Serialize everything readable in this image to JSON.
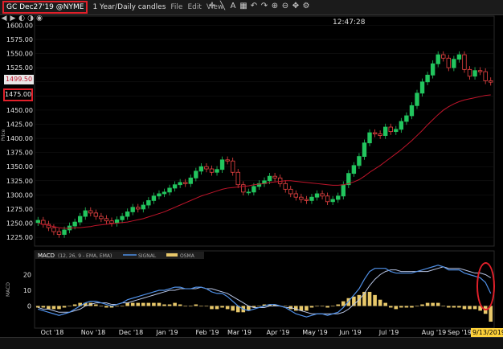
{
  "toolbar": {
    "symbol": "GC Dec27'19 @NYME",
    "timeframe": "1 Year/Daily candles",
    "menus": [
      "File",
      "Edit",
      "View"
    ],
    "icons": [
      "crosshair-icon",
      "draw-line-icon",
      "text-tool-icon",
      "grid-icon",
      "undo-icon",
      "redo-icon",
      "zoom-in-icon",
      "zoom-out-icon",
      "pan-icon",
      "settings-icon"
    ]
  },
  "clock": "12:47:28",
  "price_scale": {
    "ticks": [
      "1600.00",
      "1575.00",
      "1550.00",
      "1525.00",
      "1500.00",
      "1475.00",
      "1450.00",
      "1425.00",
      "1400.00",
      "1375.00",
      "1350.00",
      "1325.00",
      "1300.00",
      "1275.00",
      "1250.00",
      "1225.00"
    ],
    "axis_label": "Price",
    "last_price": "1499.50",
    "highlighted_price": "1475.00"
  },
  "time_axis": [
    "Oct '18",
    "Nov '18",
    "Dec '18",
    "Jan '19",
    "Feb '19",
    "Mar '19",
    "Apr '19",
    "May '19",
    "Jun '19",
    "Jul '19",
    "Aug '19",
    "Sep '19"
  ],
  "macd_panel": {
    "legend": {
      "label": "MACD",
      "params": "(12, 26, 9 - EMA, EMA)",
      "series_signal": "SIGNAL",
      "series_osma": "OSMA"
    },
    "ticks": [
      "20",
      "10",
      "0"
    ],
    "axis_label": "MACD"
  },
  "current_date": "9/13/2019",
  "colors": {
    "up_candle": "#22c55e",
    "down_candle": "#ef4444",
    "moving_average": "#c0152b",
    "macd_line": "#4f8fe6",
    "signal_line": "#b9c6e6",
    "osma_bar": "#e8c86a",
    "highlight": "#e0202a",
    "date_badge": "#ffd23a"
  },
  "chart_data": {
    "type": "candlestick",
    "ylim": [
      1218,
      1605
    ],
    "moving_average_period": "not labeled",
    "closes": [
      1255,
      1248,
      1242,
      1235,
      1230,
      1238,
      1245,
      1252,
      1262,
      1272,
      1268,
      1262,
      1258,
      1254,
      1250,
      1256,
      1262,
      1270,
      1278,
      1275,
      1282,
      1290,
      1298,
      1302,
      1305,
      1312,
      1318,
      1322,
      1320,
      1330,
      1342,
      1350,
      1346,
      1340,
      1345,
      1362,
      1360,
      1340,
      1318,
      1305,
      1305,
      1315,
      1320,
      1325,
      1333,
      1330,
      1320,
      1310,
      1302,
      1296,
      1292,
      1290,
      1296,
      1302,
      1298,
      1288,
      1292,
      1298,
      1318,
      1338,
      1352,
      1368,
      1392,
      1410,
      1408,
      1405,
      1420,
      1412,
      1416,
      1430,
      1440,
      1458,
      1480,
      1500,
      1512,
      1532,
      1548,
      1542,
      1525,
      1540,
      1548,
      1522,
      1510,
      1520,
      1518,
      1502,
      1499.5
    ],
    "moving_average": [
      1250,
      1248,
      1246,
      1244,
      1242,
      1241,
      1241,
      1242,
      1242,
      1243,
      1244,
      1246,
      1247,
      1248,
      1249,
      1250,
      1251,
      1252,
      1254,
      1256,
      1258,
      1261,
      1264,
      1267,
      1270,
      1274,
      1278,
      1282,
      1286,
      1290,
      1294,
      1298,
      1301,
      1304,
      1307,
      1310,
      1312,
      1313,
      1314,
      1315,
      1316,
      1318,
      1319,
      1320,
      1322,
      1323,
      1324,
      1325,
      1325,
      1324,
      1323,
      1322,
      1321,
      1320,
      1319,
      1318,
      1317,
      1317,
      1318,
      1320,
      1323,
      1327,
      1333,
      1340,
      1346,
      1352,
      1359,
      1366,
      1373,
      1380,
      1388,
      1396,
      1405,
      1414,
      1424,
      1433,
      1442,
      1450,
      1456,
      1461,
      1465,
      1468,
      1470,
      1472,
      1474,
      1476,
      1477
    ],
    "macd": [
      -2,
      -3,
      -4,
      -5,
      -6,
      -5,
      -4,
      -2,
      0,
      2,
      3,
      3,
      2,
      1,
      0,
      1,
      2,
      4,
      5,
      6,
      7,
      8,
      9,
      10,
      10,
      11,
      12,
      12,
      11,
      11,
      12,
      12,
      11,
      9,
      8,
      8,
      6,
      3,
      0,
      -2,
      -3,
      -2,
      -1,
      0,
      1,
      1,
      0,
      -1,
      -3,
      -5,
      -6,
      -7,
      -6,
      -5,
      -5,
      -6,
      -5,
      -4,
      -1,
      3,
      7,
      11,
      17,
      22,
      24,
      24,
      24,
      22,
      21,
      21,
      21,
      21,
      22,
      23,
      24,
      25,
      26,
      25,
      23,
      23,
      23,
      21,
      20,
      19,
      18,
      15,
      8
    ],
    "signal": [
      -1,
      -2,
      -2,
      -3,
      -4,
      -4,
      -4,
      -3,
      -2,
      0,
      1,
      2,
      2,
      2,
      1,
      1,
      2,
      2,
      3,
      4,
      5,
      6,
      7,
      8,
      9,
      10,
      10,
      11,
      11,
      11,
      11,
      12,
      11,
      11,
      10,
      9,
      8,
      6,
      4,
      2,
      0,
      -1,
      -1,
      -1,
      0,
      0,
      0,
      -1,
      -1,
      -2,
      -3,
      -4,
      -5,
      -5,
      -5,
      -5,
      -5,
      -5,
      -4,
      -2,
      1,
      4,
      8,
      13,
      17,
      20,
      22,
      23,
      23,
      22,
      22,
      22,
      22,
      22,
      22,
      23,
      24,
      25,
      24,
      24,
      24,
      23,
      22,
      21,
      21,
      20,
      18
    ],
    "osma": [
      -1,
      -1,
      -2,
      -2,
      -2,
      -1,
      0,
      1,
      2,
      2,
      2,
      1,
      0,
      -1,
      -1,
      0,
      0,
      2,
      2,
      2,
      2,
      2,
      2,
      2,
      1,
      1,
      2,
      1,
      0,
      0,
      1,
      0,
      0,
      -2,
      -2,
      -1,
      -2,
      -3,
      -4,
      -4,
      -3,
      -1,
      0,
      1,
      1,
      1,
      0,
      0,
      -2,
      -3,
      -3,
      -3,
      -1,
      0,
      0,
      -1,
      0,
      1,
      3,
      5,
      6,
      7,
      9,
      9,
      7,
      4,
      2,
      -1,
      -2,
      -1,
      -1,
      -1,
      0,
      1,
      2,
      2,
      2,
      0,
      -1,
      -1,
      -1,
      -2,
      -2,
      -2,
      -3,
      -5,
      -10
    ]
  }
}
